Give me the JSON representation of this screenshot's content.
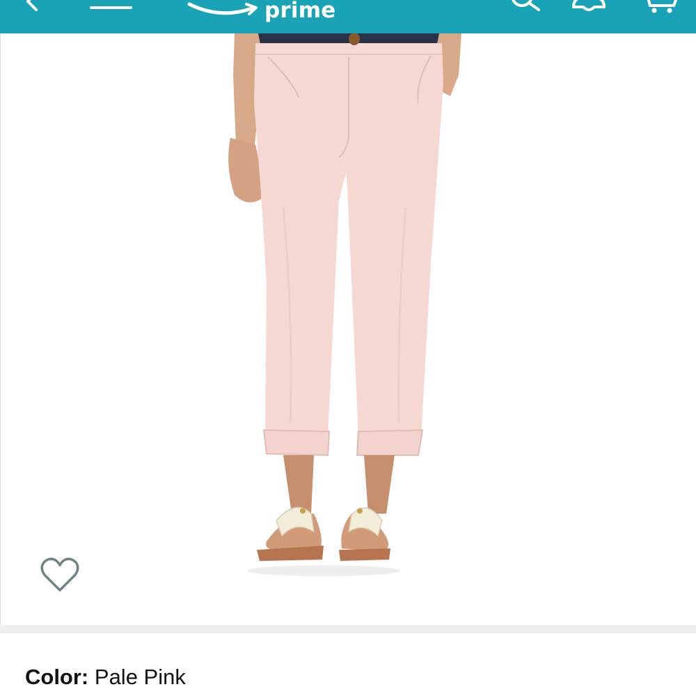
{
  "header": {
    "background": "#1aa3b6",
    "logo_text": "prime",
    "icons": [
      "back-arrow-icon",
      "menu-icon",
      "amazon-smile-logo",
      "search-icon",
      "account-icon",
      "cart-icon"
    ]
  },
  "gallery": {
    "image_alt": "Pale pink cropped chino pants with cuffed hems, worn with white thong sandals",
    "wishlist_icon": "heart-outline-icon",
    "image_count": 4,
    "active_index": 0
  },
  "variation": {
    "label": "Color:",
    "value": "Pale Pink"
  }
}
